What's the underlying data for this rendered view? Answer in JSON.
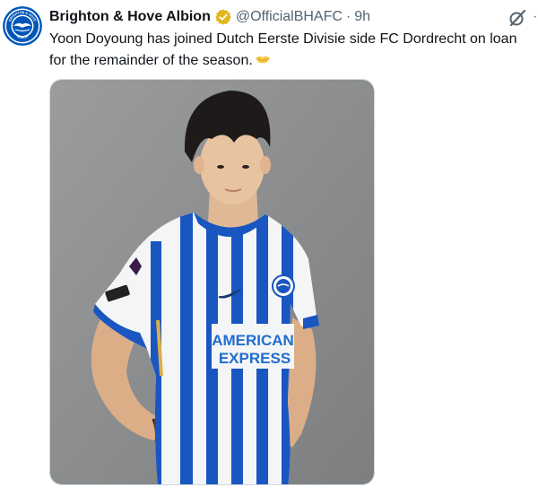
{
  "tweet": {
    "display_name": "Brighton & Hove Albion",
    "handle": "@OfficialBHAFC",
    "separator": "·",
    "time": "9h",
    "text": "Yoon Doyoung has joined Dutch Eerste Divisie side FC Dordrecht on loan for the remainder of the season.",
    "emoji": "handshake-emoji",
    "verified_icon": "gold-verified-badge-icon",
    "grok_icon": "grok-icon",
    "more_icon": "more-options-icon"
  },
  "avatar": {
    "logo_top_text": "BRIGHTON & HOVE",
    "logo_bottom_text": "ALBION",
    "colors": {
      "blue": "#0057b8",
      "white": "#ffffff"
    }
  },
  "media": {
    "background_color": "#8b8d8e",
    "shirt_sponsor_line1": "AMERICAN",
    "shirt_sponsor_line2": "EXPRESS",
    "stripe_color": "#1a56c0",
    "alt": "player photo"
  },
  "colors": {
    "text": "#0f1419",
    "secondary": "#536471",
    "verified_gold": "#e2b719",
    "border": "#cfd9de"
  }
}
